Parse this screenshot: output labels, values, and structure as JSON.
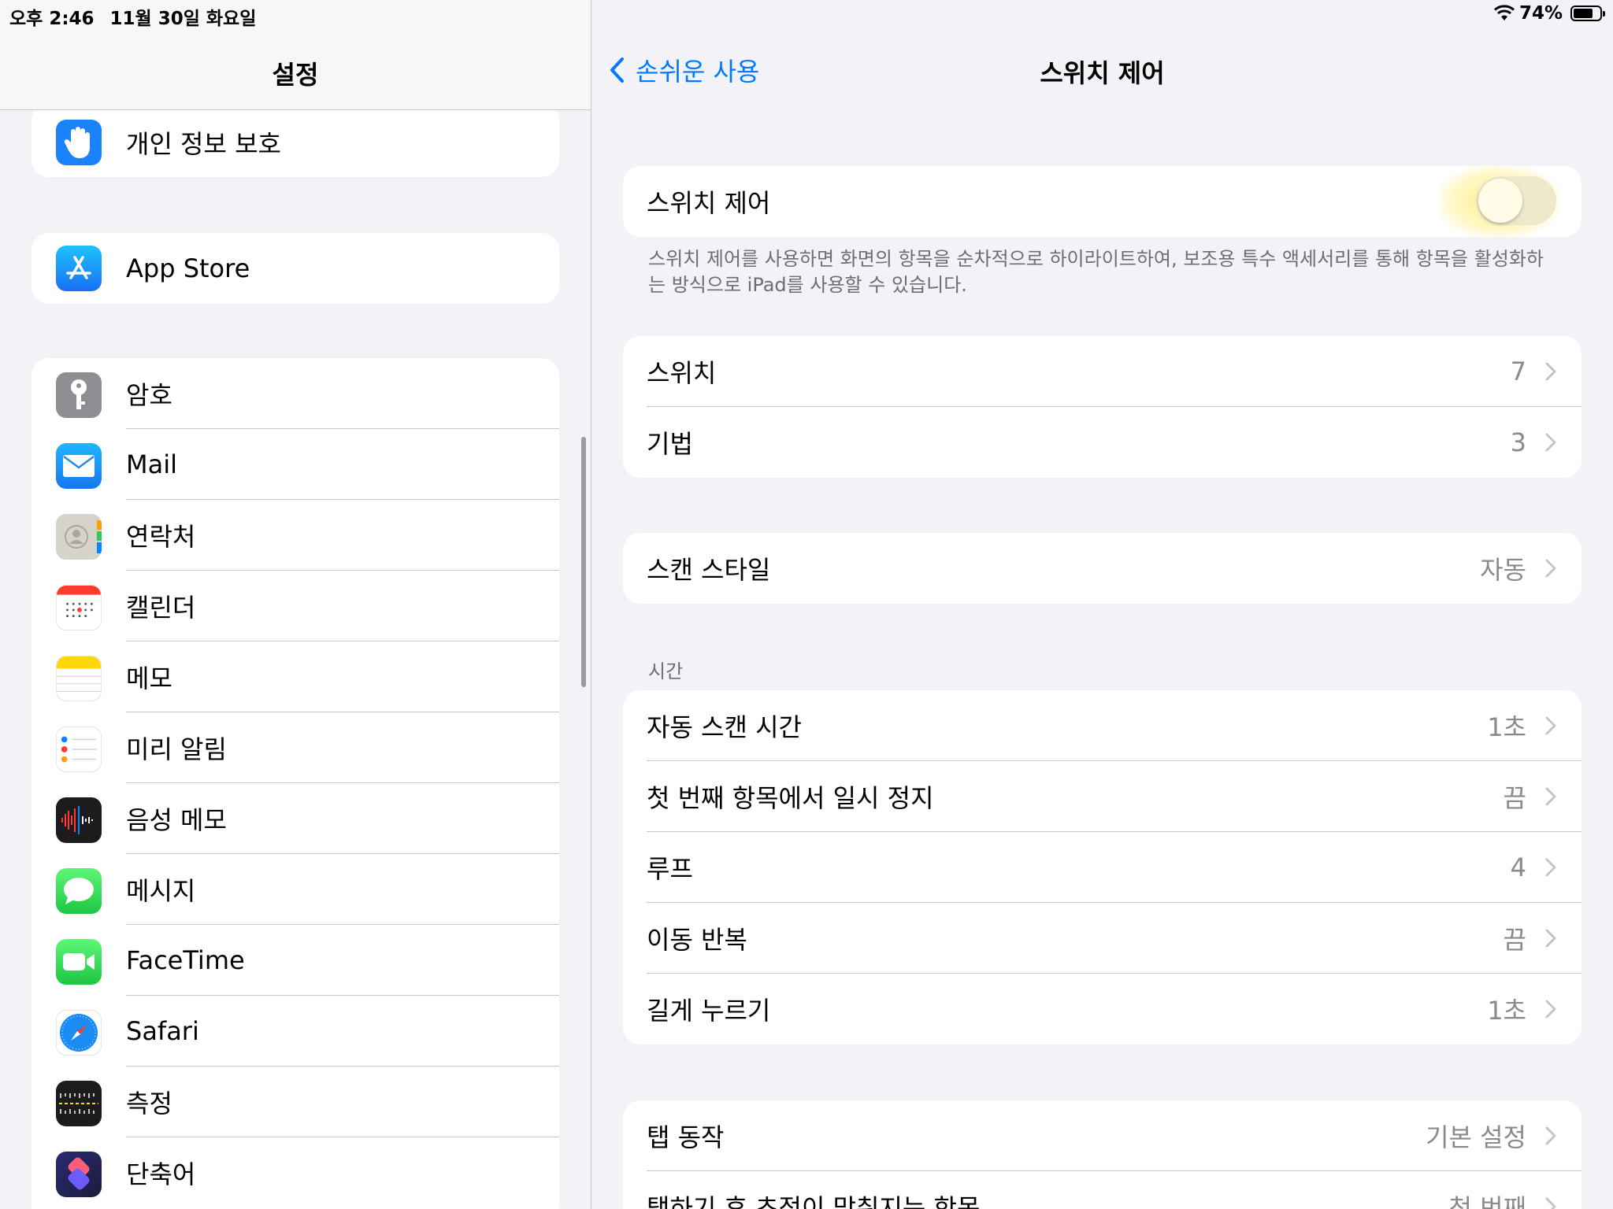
{
  "status_bar": {
    "time": "오후 2:46",
    "date": "11월 30일 화요일",
    "battery": "74%",
    "battery_level": 0.74
  },
  "sidebar": {
    "title": "설정",
    "group1": [
      {
        "label": "개인 정보 보호",
        "icon": "hand-icon",
        "color": "#1a82fb"
      }
    ],
    "group2": [
      {
        "label": "App Store",
        "icon": "app-store-icon",
        "color": "#1c9bf6"
      }
    ],
    "group3": [
      {
        "label": "암호",
        "icon": "key-icon",
        "color": "#8e8e93"
      },
      {
        "label": "Mail",
        "icon": "mail-icon",
        "color": "#2196f3"
      },
      {
        "label": "연락처",
        "icon": "contacts-icon",
        "color": "#cfcbc5"
      },
      {
        "label": "캘린더",
        "icon": "calendar-icon",
        "color": "#ffffff"
      },
      {
        "label": "메모",
        "icon": "notes-icon",
        "color": "#ffd60a"
      },
      {
        "label": "미리 알림",
        "icon": "reminders-icon",
        "color": "#ffffff"
      },
      {
        "label": "음성 메모",
        "icon": "voice-memos-icon",
        "color": "#1c1c1e"
      },
      {
        "label": "메시지",
        "icon": "messages-icon",
        "color": "#34c759"
      },
      {
        "label": "FaceTime",
        "icon": "facetime-icon",
        "color": "#30c85a"
      },
      {
        "label": "Safari",
        "icon": "safari-icon",
        "color": "#ffffff"
      },
      {
        "label": "측정",
        "icon": "measure-icon",
        "color": "#1c1c1e"
      },
      {
        "label": "단축어",
        "icon": "shortcuts-icon",
        "color": "#5b47d6"
      }
    ]
  },
  "detail": {
    "back_label": "손쉬운 사용",
    "title": "스위치 제어",
    "toggle": {
      "label": "스위치 제어",
      "on": false
    },
    "toggle_footer": "스위치 제어를 사용하면 화면의 항목을 순차적으로 하이라이트하여, 보조용 특수 액세서리를 통해 항목을 활성화하는 방식으로 iPad를 사용할 수 있습니다.",
    "group_switches": [
      {
        "label": "스위치",
        "value": "7"
      },
      {
        "label": "기법",
        "value": "3"
      }
    ],
    "group_scan": [
      {
        "label": "스캔 스타일",
        "value": "자동"
      }
    ],
    "timing_header": "시간",
    "group_timing": [
      {
        "label": "자동 스캔 시간",
        "value": "1초"
      },
      {
        "label": "첫 번째 항목에서 일시 정지",
        "value": "끔"
      },
      {
        "label": "루프",
        "value": "4"
      },
      {
        "label": "이동 반복",
        "value": "끔"
      },
      {
        "label": "길게 누르기",
        "value": "1초"
      }
    ],
    "group_tap": [
      {
        "label": "탭 동작",
        "value": "기본 설정"
      },
      {
        "label": "탭하기 후 초점이 맞춰지는 항목",
        "value": "첫 번째"
      }
    ]
  }
}
